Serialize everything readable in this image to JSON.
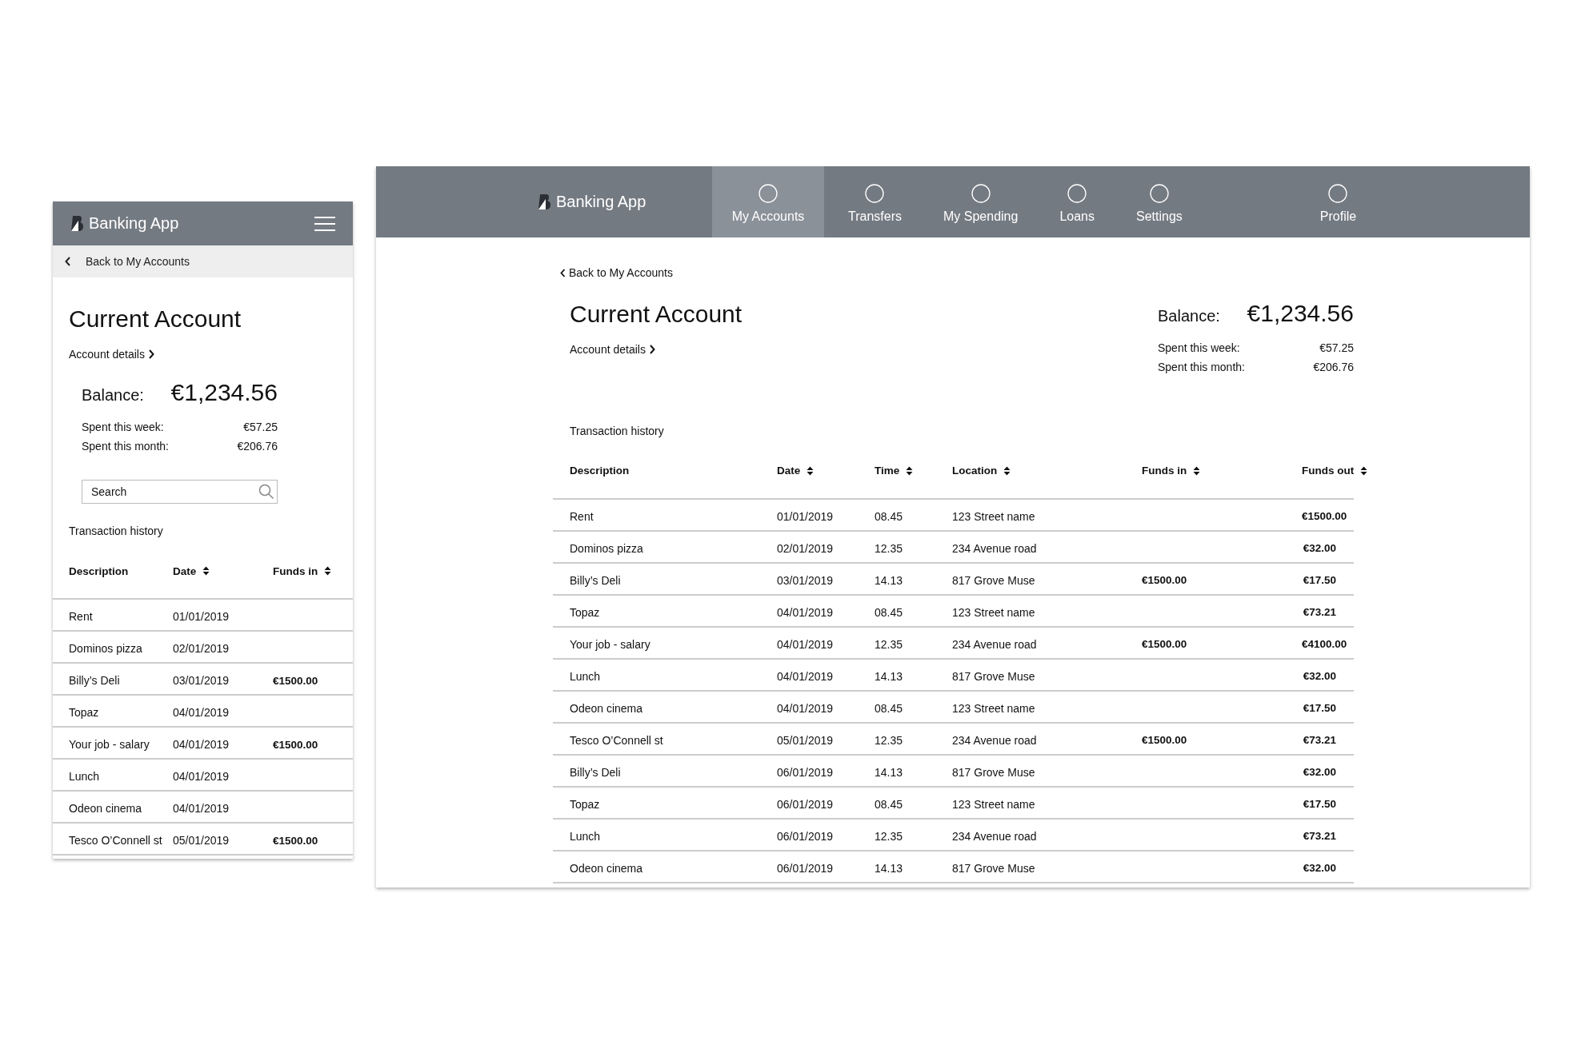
{
  "mobile": {
    "app_title": "Banking App",
    "back_link": "Back to My Accounts",
    "title": "Current Account",
    "details_link": "Account details",
    "balance_label": "Balance:",
    "balance": "€1,234.56",
    "spent": [
      {
        "label": "Spent this week:",
        "value": "€57.25"
      },
      {
        "label": "Spent this month:",
        "value": "€206.76"
      }
    ],
    "search": {
      "placeholder": "Search"
    },
    "history_title": "Transaction history",
    "columns": [
      {
        "label": "Description",
        "sortable": false
      },
      {
        "label": "Date",
        "sortable": true
      },
      {
        "label": "Funds in",
        "sortable": true
      }
    ],
    "rows": [
      {
        "description": "Rent",
        "date": "01/01/2019"
      },
      {
        "description": "Dominos pizza",
        "date": "02/01/2019"
      },
      {
        "description": "Billy’s Deli",
        "date": "03/01/2019",
        "funds_in": "€1500.00"
      },
      {
        "description": "Topaz",
        "date": "04/01/2019"
      },
      {
        "description": "Your job - salary",
        "date": "04/01/2019",
        "funds_in": "€1500.00"
      },
      {
        "description": "Lunch",
        "date": "04/01/2019"
      },
      {
        "description": "Odeon cinema",
        "date": "04/01/2019"
      },
      {
        "description": "Tesco O’Connell st",
        "date": "05/01/2019",
        "funds_in": "€1500.00"
      }
    ]
  },
  "desktop": {
    "app_title": "Banking App",
    "nav": [
      {
        "label": "My Accounts",
        "selected": true
      },
      {
        "label": "Transfers",
        "selected": false
      },
      {
        "label": "My Spending",
        "selected": false
      },
      {
        "label": "Loans",
        "selected": false
      },
      {
        "label": "Settings",
        "selected": false
      }
    ],
    "profile_link": "Profile",
    "back_link": "Back to My Accounts",
    "title": "Current Account",
    "details_link": "Account details",
    "balance_label": "Balance:",
    "balance": "€1,234.56",
    "spent": [
      {
        "label": "Spent this week:",
        "value": "€57.25"
      },
      {
        "label": "Spent this month:",
        "value": "€206.76"
      }
    ],
    "history_title": "Transaction history",
    "columns": [
      {
        "label": "Description",
        "sortable": false
      },
      {
        "label": "Date",
        "sortable": true
      },
      {
        "label": "Time",
        "sortable": true
      },
      {
        "label": "Location",
        "sortable": true
      },
      {
        "label": "Funds in",
        "sortable": true
      },
      {
        "label": "Funds out",
        "sortable": true
      }
    ],
    "rows": [
      {
        "description": "Rent",
        "date": "01/01/2019",
        "time": "08.45",
        "location": "123 Street name",
        "funds_out": "€1500.00"
      },
      {
        "description": "Dominos pizza",
        "date": "02/01/2019",
        "time": "12.35",
        "location": "234 Avenue road",
        "funds_out": "€32.00"
      },
      {
        "description": "Billy’s Deli",
        "date": "03/01/2019",
        "time": "14.13",
        "location": "817 Grove Muse",
        "funds_in": "€1500.00",
        "funds_out": "€17.50"
      },
      {
        "description": "Topaz",
        "date": "04/01/2019",
        "time": "08.45",
        "location": "123 Street name",
        "funds_out": "€73.21"
      },
      {
        "description": "Your job - salary",
        "date": "04/01/2019",
        "time": "12.35",
        "location": "234 Avenue road",
        "funds_in": "€1500.00",
        "funds_out": "€4100.00"
      },
      {
        "description": "Lunch",
        "date": "04/01/2019",
        "time": "14.13",
        "location": "817 Grove Muse",
        "funds_out": "€32.00"
      },
      {
        "description": "Odeon cinema",
        "date": "04/01/2019",
        "time": "08.45",
        "location": "123 Street name",
        "funds_out": "€17.50"
      },
      {
        "description": "Tesco O’Connell st",
        "date": "05/01/2019",
        "time": "12.35",
        "location": "234 Avenue road",
        "funds_in": "€1500.00",
        "funds_out": "€73.21"
      },
      {
        "description": "Billy’s Deli",
        "date": "06/01/2019",
        "time": "14.13",
        "location": "817 Grove Muse",
        "funds_out": "€32.00"
      },
      {
        "description": "Topaz",
        "date": "06/01/2019",
        "time": "08.45",
        "location": "123 Street name",
        "funds_out": "€17.50"
      },
      {
        "description": "Lunch",
        "date": "06/01/2019",
        "time": "12.35",
        "location": "234 Avenue road",
        "funds_out": "€73.21"
      },
      {
        "description": "Odeon cinema",
        "date": "06/01/2019",
        "time": "14.13",
        "location": "817 Grove Muse",
        "funds_out": "€32.00"
      }
    ]
  }
}
